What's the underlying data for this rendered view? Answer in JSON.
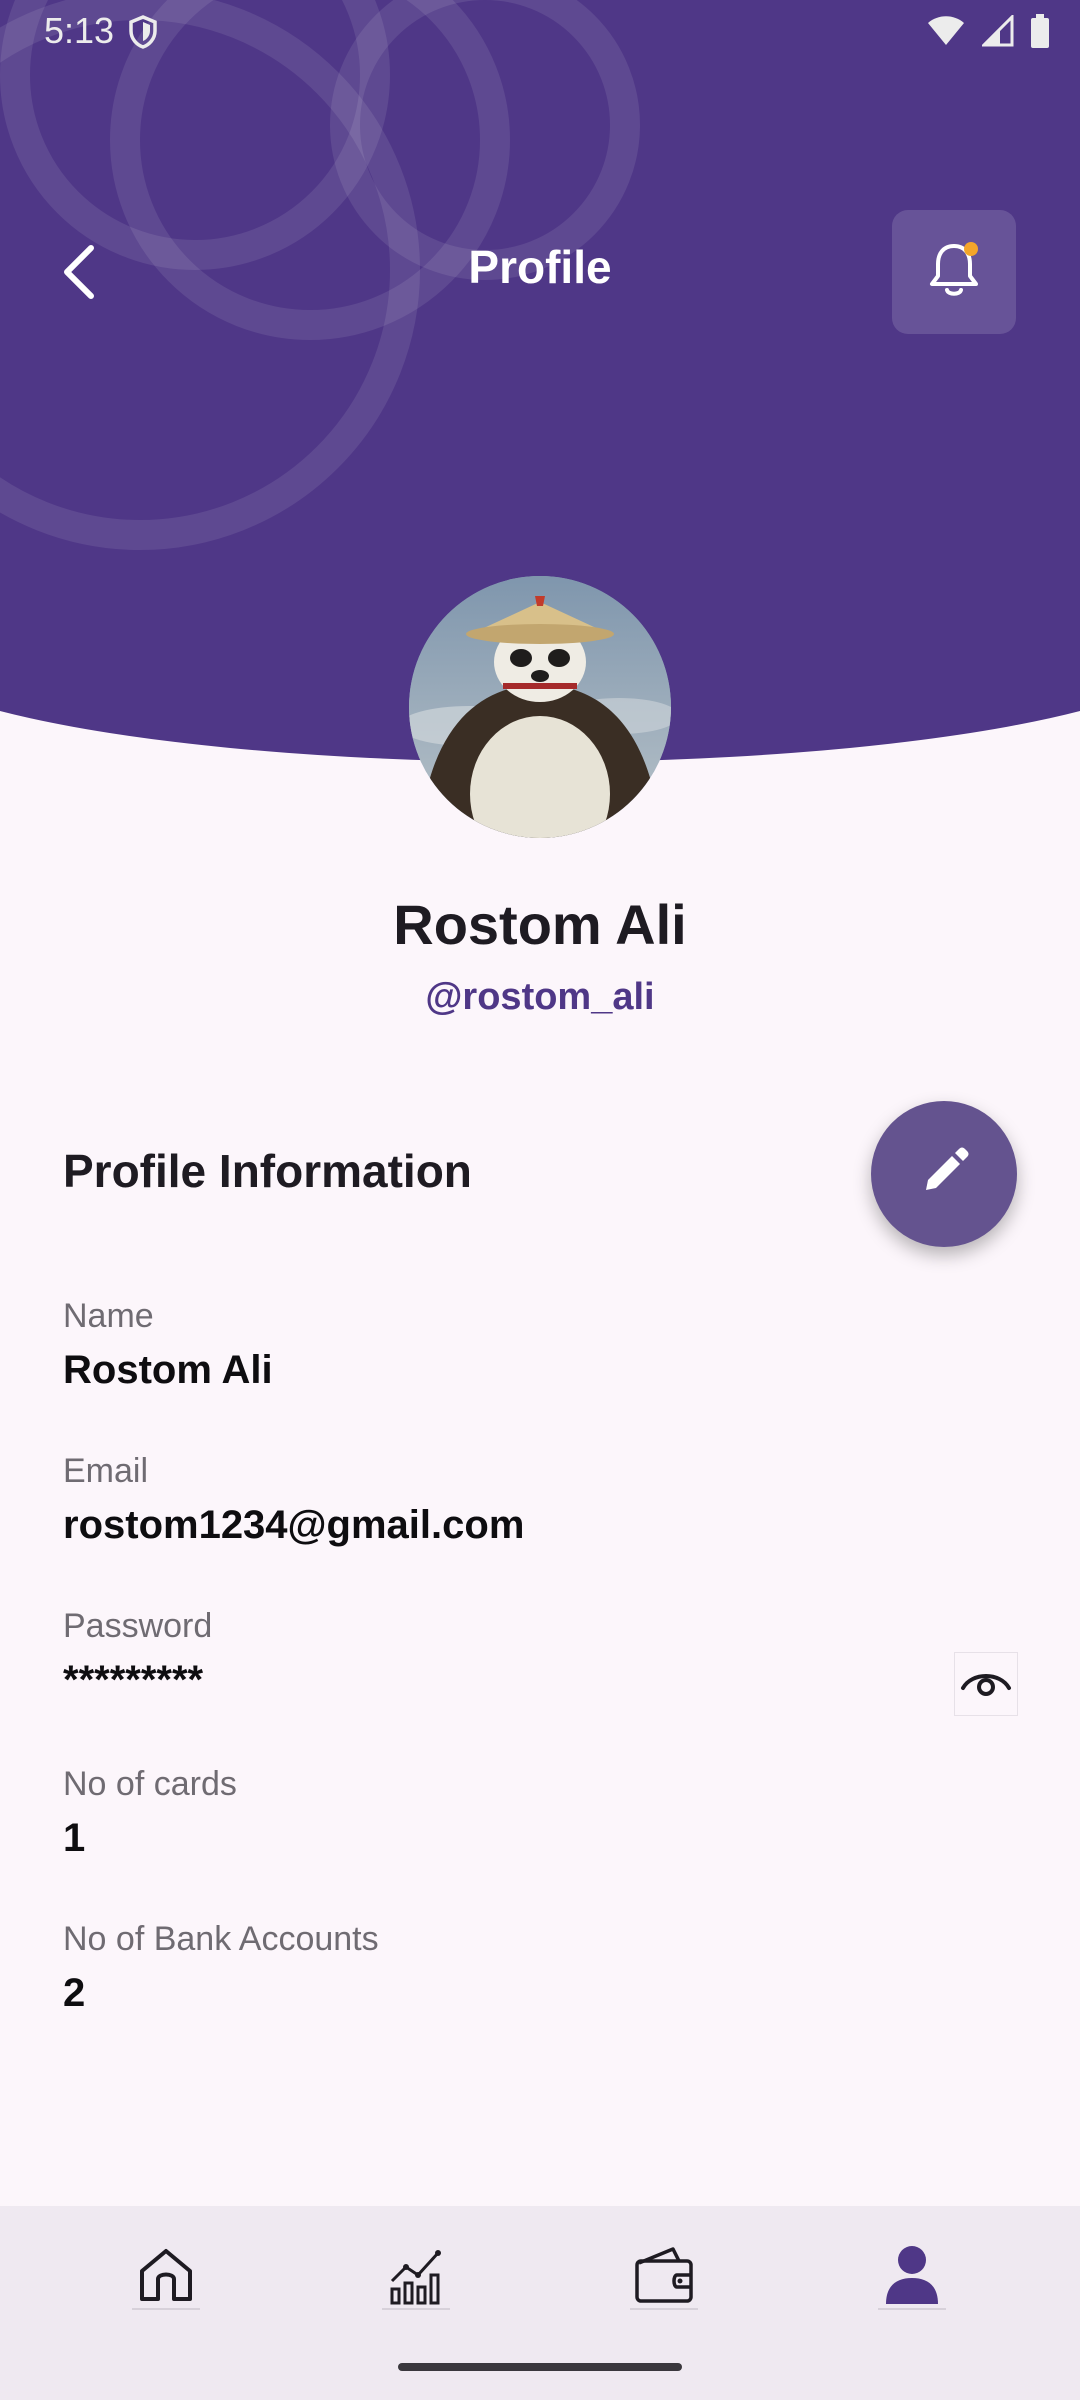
{
  "status_bar": {
    "time": "5:13"
  },
  "header": {
    "title": "Profile"
  },
  "profile": {
    "name": "Rostom Ali",
    "handle": "@rostom_ali"
  },
  "section": {
    "title": "Profile Information"
  },
  "fields": [
    {
      "label": "Name",
      "value": "Rostom Ali"
    },
    {
      "label": "Email",
      "value": "rostom1234@gmail.com"
    },
    {
      "label": "Password",
      "value": "*********"
    },
    {
      "label": "No of cards",
      "value": "1"
    },
    {
      "label": "No of Bank Accounts",
      "value": "2"
    }
  ],
  "icons": {
    "back": "chevron-left-icon",
    "notification": "bell-icon",
    "edit": "pencil-icon",
    "password_toggle": "eye-icon",
    "nav": [
      "home-icon",
      "chart-icon",
      "wallet-icon",
      "person-icon"
    ]
  },
  "colors": {
    "primary": "#4f3787",
    "fab": "#64538f",
    "notification_dot": "#f4a52a",
    "background": "#fcf6fb"
  },
  "bottom_nav": {
    "active_index": 3
  }
}
